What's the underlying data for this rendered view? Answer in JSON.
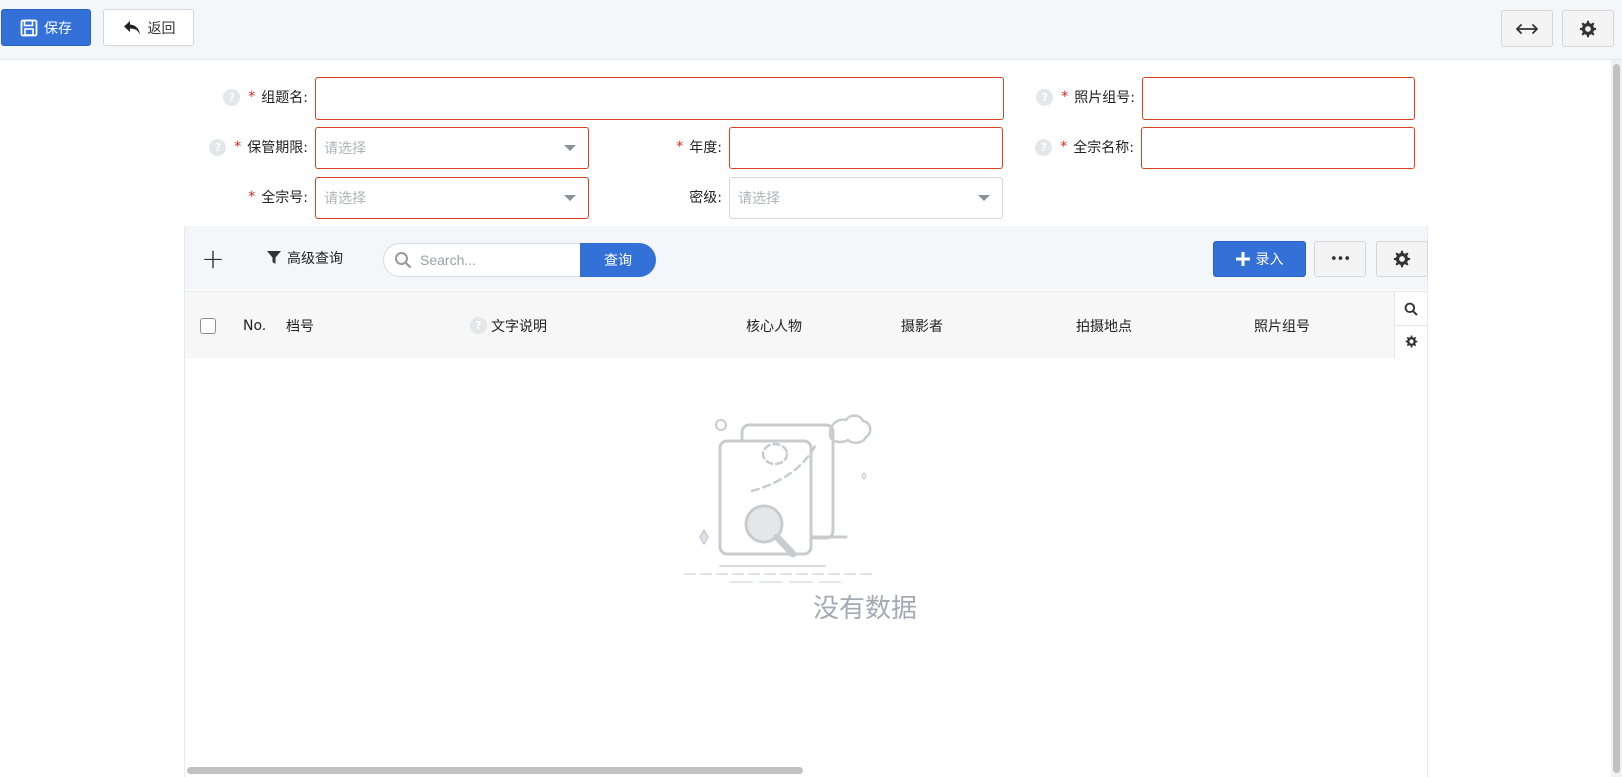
{
  "toolbar": {
    "save_label": "保存",
    "back_label": "返回"
  },
  "form": {
    "group_title": {
      "label": "组题名:",
      "required": "*",
      "help": "?",
      "value": ""
    },
    "photo_group_no": {
      "label": "照片组号:",
      "required": "*",
      "help": "?",
      "value": ""
    },
    "retention_period": {
      "label": "保管期限:",
      "required": "*",
      "help": "?",
      "placeholder": "请选择"
    },
    "year": {
      "label": "年度:",
      "required": "*",
      "value": ""
    },
    "fonds_full_name": {
      "label": "全宗名称:",
      "required": "*",
      "help": "?",
      "value": ""
    },
    "fonds_no": {
      "label": "全宗号:",
      "required": "*",
      "placeholder": "请选择"
    },
    "security_level": {
      "label": "密级:",
      "placeholder": "请选择"
    }
  },
  "grid": {
    "toolbar": {
      "add_icon": "+",
      "advanced_query_label": "高级查询",
      "search_placeholder": "Search...",
      "query_button_label": "查询",
      "entry_button_label": "录入",
      "more_icon": "•••"
    },
    "columns": [
      "No.",
      "档号",
      "文字说明",
      "核心人物",
      "摄影者",
      "拍摄地点",
      "照片组号"
    ],
    "column_help": "?",
    "rows": [],
    "empty_text": "没有数据"
  },
  "colors": {
    "primary": "#3370d8",
    "required_border": "#e0411c",
    "required_star": "#e02020",
    "toolbar_bg": "#f4f7fa"
  }
}
